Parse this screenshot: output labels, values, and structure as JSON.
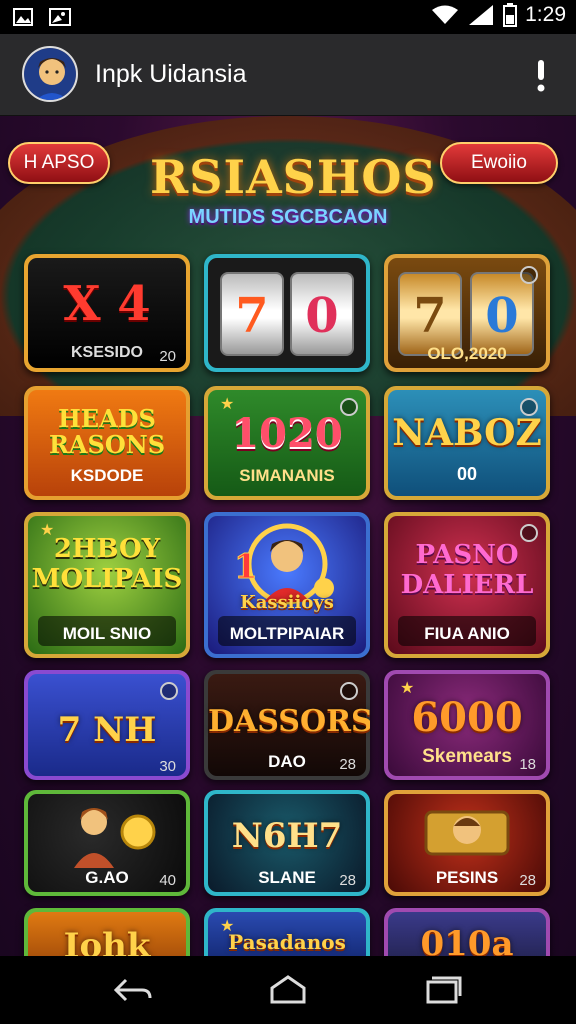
{
  "status": {
    "time": "1:29",
    "icons": [
      "image-icon",
      "gallery-icon",
      "wifi-icon",
      "signal-icon",
      "battery-icon"
    ]
  },
  "app": {
    "title": "Inpk Uidansia",
    "avatar": "avatar-icon",
    "menu_icon": "more-vert-icon"
  },
  "banner": {
    "left_pill": "H APSO",
    "right_pill": "Ewoiio",
    "title": "RSIASHOS",
    "subtitle": "MUTIDS SGCBCAON"
  },
  "tiles": [
    {
      "main": "X 4",
      "sub": "KSESIDO",
      "num": "20"
    },
    {
      "main": "7 0",
      "sub": ""
    },
    {
      "main": "7 0",
      "sub": "OLO,2020"
    },
    {
      "main": "HEADS RASONS",
      "sub": "KSDODE"
    },
    {
      "main": "1020",
      "sub": "SIMANANIS"
    },
    {
      "main": "NABOZ",
      "sub": "00"
    },
    {
      "main": "2HBOY MOLIPAIS",
      "sub": "MOIL SNIO"
    },
    {
      "main": "Kassiioys",
      "sub": "MOLTPIPAIAR"
    },
    {
      "main": "PASNO DALIERL",
      "sub": "FIUA ANIO"
    },
    {
      "main": "7 NH",
      "sub": "",
      "num": "30"
    },
    {
      "main": "DASSORS",
      "sub": "DAO",
      "num": "28"
    },
    {
      "main": "6000",
      "sub": "Skemears",
      "num": "18"
    },
    {
      "main": "",
      "sub": "G.AO",
      "num": "40"
    },
    {
      "main": "N6H7",
      "sub": "SLANE",
      "num": "28"
    },
    {
      "main": "",
      "sub": "PESINS",
      "num": "28"
    },
    {
      "main": "Iohk",
      "sub": ""
    },
    {
      "main": "Pasadanos",
      "sub": ""
    },
    {
      "main": "010a",
      "sub": ""
    }
  ],
  "colors": {
    "app_bar": "#2a2a2c",
    "gold": "#ffd24a",
    "red_pill": "#c42026"
  },
  "nav": {
    "icons": [
      "back-icon",
      "home-icon",
      "recents-icon"
    ]
  }
}
